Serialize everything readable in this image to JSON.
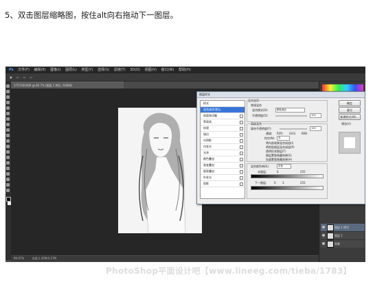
{
  "instruction": "5、双击图层缩略图，按住alt向右拖动下一图层。",
  "watermark": "PhotoShop平面设计吧【www.lineeg.com/tieba/1783】",
  "photoshop": {
    "app_logo": "Ps",
    "menu": [
      "文件(F)",
      "编辑(E)",
      "图像(I)",
      "图层(L)",
      "类型(Y)",
      "选择(S)",
      "滤镜(T)",
      "3D(D)",
      "视图(V)",
      "窗口(W)",
      "帮助(H)"
    ],
    "document_tab": "1757201609 @ 66.7% (图层 1 拷贝, RGB/8)",
    "status_zoom": "66.67%",
    "status_doc": "文档:1.42M/4.27M",
    "layers": [
      {
        "name": "图层 1 拷贝"
      },
      {
        "name": "图层 1"
      },
      {
        "name": "背景"
      }
    ]
  },
  "dialog": {
    "title": "图层样式",
    "styles": [
      "样式",
      "混合选项:默认",
      "斜面和浮雕",
      "等高线",
      "纹理",
      "描边",
      "内阴影",
      "内发光",
      "光泽",
      "颜色叠加",
      "渐变叠加",
      "图案叠加",
      "外发光",
      "投影"
    ],
    "section_general": "混合选项",
    "general_blending": "常规混合",
    "blend_mode_label": "混合模式(D):",
    "blend_mode_value": "颜色减淡",
    "opacity_label": "不透明度(O):",
    "opacity_value": "100",
    "section_advanced": "高级混合",
    "fill_opacity_label": "填充不透明度(F):",
    "fill_opacity_value": "100",
    "channels_label": "通道:",
    "channels": [
      "R(R)",
      "G(G)",
      "B(B)"
    ],
    "knockout_label": "挖空(N):",
    "knockout_value": "无",
    "adv_options": [
      "将内部效果混合成组(I)",
      "将剪贴图层混合成组(P)",
      "透明形状图层(T)",
      "图层蒙版隐藏效果(S)",
      "矢量蒙版隐藏效果(H)"
    ],
    "blend_if_label": "混合颜色带(E):",
    "blend_if_value": "灰色",
    "this_layer_label": "本图层:",
    "this_layer_values": [
      "0",
      "255"
    ],
    "underlying_label": "下一图层:",
    "underlying_values": [
      "0",
      "3",
      "255"
    ],
    "buttons": {
      "ok": "确定",
      "reset": "复位",
      "new_style": "新建样式(W)...",
      "preview": "预览(V)"
    }
  },
  "colors": {
    "ps_bg": "#262626",
    "dialog_bg": "#eeeeee",
    "selected": "#3875d7"
  }
}
